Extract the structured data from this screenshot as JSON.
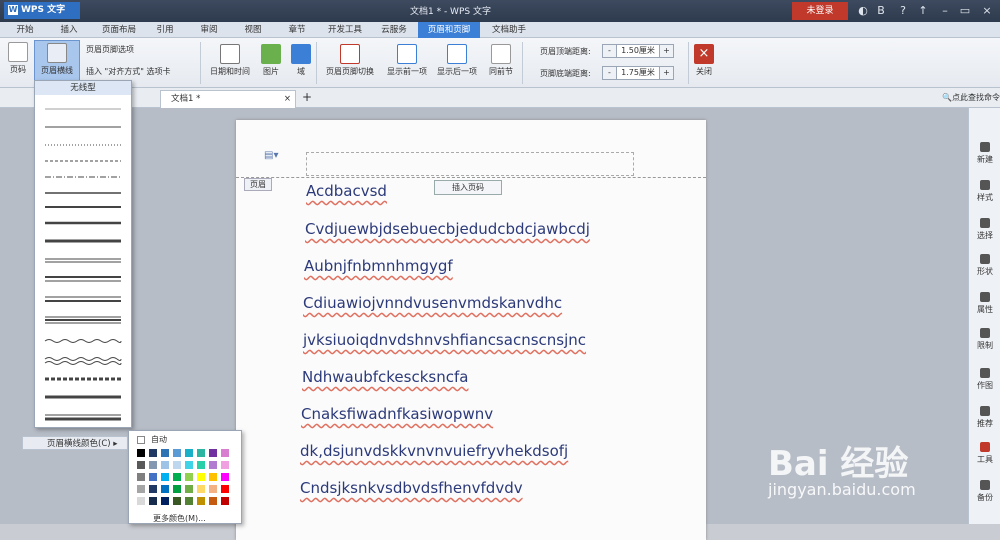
{
  "app": {
    "name": "WPS 文字",
    "title": "文档1 * - WPS 文字",
    "login": "未登录"
  },
  "tabs": [
    "开始",
    "插入",
    "页面布局",
    "引用",
    "审阅",
    "视图",
    "章节",
    "开发工具",
    "云服务",
    "页眉和页脚",
    "文档助手"
  ],
  "ribbon": {
    "page_number": "页码",
    "header_line": "页眉横线",
    "hf_options": "页眉页脚选项",
    "insert_align_tab": "插入 \"对齐方式\" 选项卡",
    "date_time": "日期和时间",
    "picture": "图片",
    "field": "域",
    "switch": "页眉页脚切换",
    "prev": "显示前一项",
    "next": "显示后一项",
    "same_as_prev": "同前节",
    "header_top_label": "页眉顶端距离:",
    "header_top_value": "1.50厘米",
    "footer_bottom_label": "页脚底端距离:",
    "footer_bottom_value": "1.75厘米",
    "close": "关闭"
  },
  "doc_tab": "文档1 *",
  "search": "点此查找命令",
  "dropdown": {
    "none": "无线型",
    "color_label": "页眉横线颜色(C)",
    "auto": "自动",
    "more_colors": "更多颜色(M)..."
  },
  "page": {
    "header_label": "页眉",
    "insert_page_number": "插入页码"
  },
  "doc_lines": [
    "Acdbacvsd",
    "Cvdjuewbjdsebuecbjedudcbdcjawbcdj",
    "Aubnjfnbmnhmgygf",
    "Cdiuawiojvnndvusenvmdskanvdhc",
    "jvksiuoiqdnvdshnvshfiancsacnscnsjnc",
    "Ndhwaubfckescksncfa",
    "Cnaksfiwadnfkasiwopwnv",
    "dk,dsjunvdskkvnvnvuiefryvhekdsofj",
    "Cndsjksnkvsdbvdsfhenvfdvdv"
  ],
  "right_panel": [
    "新建",
    "样式",
    "选择",
    "形状",
    "属性",
    "限制",
    "作图",
    "推荐",
    "工具",
    "备份"
  ],
  "watermark": {
    "logo": "Bai 经验",
    "url": "jingyan.baidu.com"
  },
  "colors": {
    "accent": "#3b7fd6",
    "login": "#c0392b"
  }
}
